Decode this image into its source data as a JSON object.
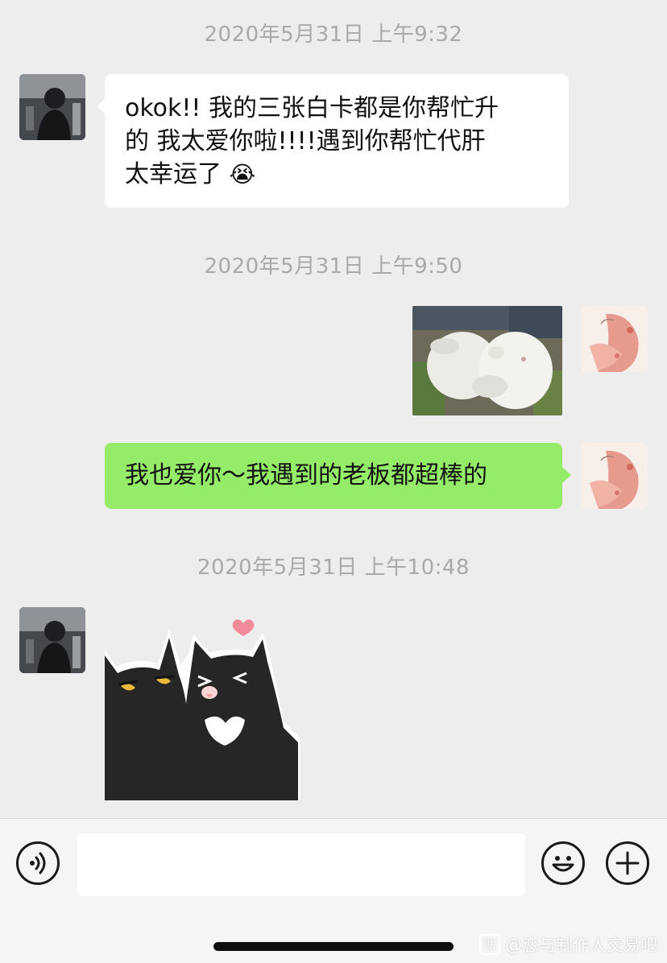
{
  "messages": {
    "ts1": "2020年5月31日 上午9:32",
    "msg1_line1": "okok!!  我的三张白卡都是你帮忙升",
    "msg1_line2": "的  我太爱你啦!!!!遇到你帮忙代肝",
    "msg1_line3": "太幸运了",
    "msg1_emoji": "😭",
    "ts2": "2020年5月31日 上午9:50",
    "msg3_text": "我也爱你～我遇到的老板都超棒的",
    "ts3": "2020年5月31日 上午10:48"
  },
  "input_bar": {
    "placeholder": "",
    "voice_icon": "voice-wave-icon",
    "emoji_icon": "smiley-icon",
    "plus_icon": "plus-icon"
  },
  "watermark": {
    "logo": "贴",
    "text": "@恋与制作人交易吧"
  },
  "colors": {
    "background": "#ededed",
    "incoming_bubble": "#ffffff",
    "outgoing_bubble": "#95ec69",
    "timestamp": "#a9a9a9"
  }
}
